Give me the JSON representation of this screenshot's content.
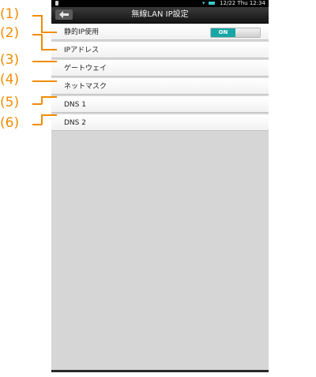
{
  "status_bar": {
    "time": "12/22 Thu 12:34"
  },
  "header": {
    "title": "無線LAN IP設定"
  },
  "settings": [
    {
      "label": "静的IP使用",
      "toggle_on_label": "ON",
      "toggle_off_label": "",
      "toggle_state": "on"
    },
    {
      "label": "IPアドレス"
    },
    {
      "label": "ゲートウェイ"
    },
    {
      "label": "ネットマスク"
    },
    {
      "label": "DNS 1"
    },
    {
      "label": "DNS 2"
    }
  ],
  "callouts": [
    "(1)",
    "(2)",
    "(3)",
    "(4)",
    "(5)",
    "(6)"
  ],
  "colors": {
    "accent": "#17a5a5",
    "callout": "#f08c00",
    "background": "#d6d6d6"
  }
}
